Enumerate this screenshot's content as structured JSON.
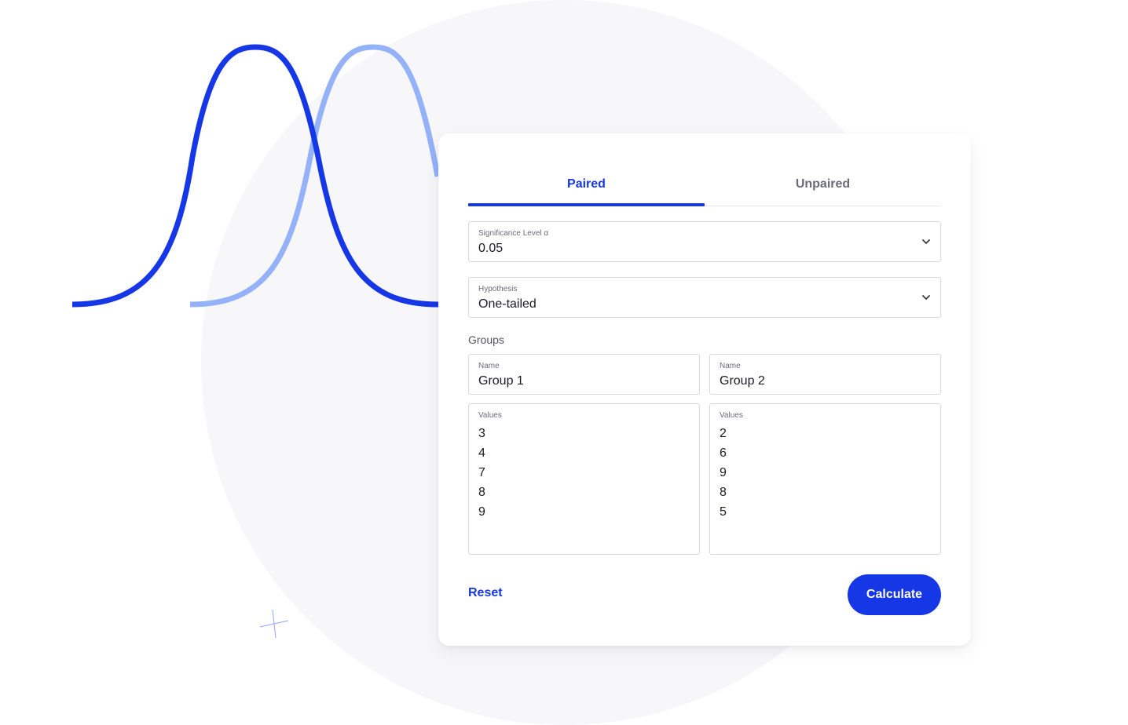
{
  "colors": {
    "accent": "#1637e6",
    "accent_light": "#93b2fa",
    "background_circle": "#f7f7f9"
  },
  "tabs": [
    {
      "label": "Paired",
      "active": true
    },
    {
      "label": "Unpaired",
      "active": false
    }
  ],
  "significance": {
    "label": "Significance Level α",
    "value": "0.05"
  },
  "hypothesis": {
    "label": "Hypothesis",
    "value": "One-tailed"
  },
  "groups": {
    "section_label": "Groups",
    "group1": {
      "name_label": "Name",
      "name_value": "Group 1",
      "values_label": "Values",
      "values": [
        "3",
        "4",
        "7",
        "8",
        "9"
      ]
    },
    "group2": {
      "name_label": "Name",
      "name_value": "Group 2",
      "values_label": "Values",
      "values": [
        "2",
        "6",
        "9",
        "8",
        "5"
      ]
    }
  },
  "actions": {
    "reset_label": "Reset",
    "calculate_label": "Calculate"
  },
  "icons": {
    "dropdown": "chevron-down-icon",
    "decor_cross": "crosshair-icon"
  }
}
